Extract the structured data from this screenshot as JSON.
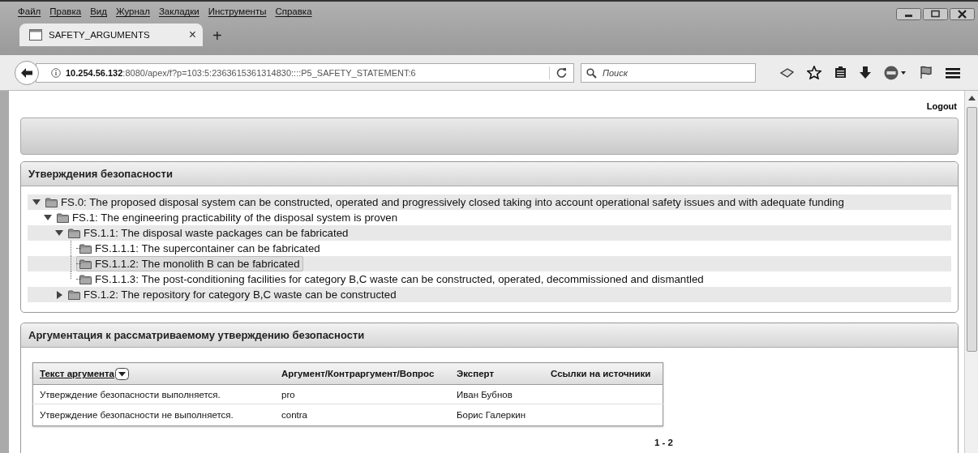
{
  "menu": [
    {
      "label": "Файл"
    },
    {
      "label": "Правка"
    },
    {
      "label": "Вид"
    },
    {
      "label": "Журнал"
    },
    {
      "label": "Закладки"
    },
    {
      "label": "Инструменты"
    },
    {
      "label": "Справка"
    }
  ],
  "tabs": [
    {
      "label": "SAFETY_ARGUMENTS",
      "selected": true
    }
  ],
  "tab_close": "×",
  "new_tab": "+",
  "address_bar": {
    "url": "**10.254.56.132**:8080/apex/f?p=103:5:2363615361314830::::P5_SAFETY_STATEMENT:6"
  },
  "search": {
    "placeholder": "Поиск"
  },
  "page": {
    "logout": "Logout",
    "statements_panel": {
      "title": "Утверждения безопасности",
      "tree": [
        {
          "kind": "branch",
          "expanded": true,
          "selected": false,
          "label": "FS.0: The proposed disposal system can be constructed, operated and progressively closed taking into account operational safety issues and with adequate funding",
          "children": [
            {
              "kind": "branch",
              "expanded": true,
              "selected": false,
              "label": "FS.1: The engineering practicability of the disposal system is proven",
              "children": [
                {
                  "kind": "branch",
                  "expanded": true,
                  "selected": false,
                  "label": "FS.1.1: The disposal waste packages can be fabricated",
                  "children": [
                    {
                      "kind": "leaf",
                      "selected": false,
                      "label": "FS.1.1.1: The supercontainer can be fabricated"
                    },
                    {
                      "kind": "leaf",
                      "selected": true,
                      "label": "FS.1.1.2: The monolith B can be fabricated"
                    },
                    {
                      "kind": "leaf",
                      "selected": false,
                      "label": "FS.1.1.3: The post-conditioning facilities for category B,C waste can be constructed, operated, decommissioned and dismantled"
                    }
                  ]
                },
                {
                  "kind": "branch",
                  "expanded": false,
                  "selected": false,
                  "label": "FS.1.2: The repository for category B,C waste can be constructed"
                }
              ]
            }
          ]
        }
      ]
    },
    "arguments_panel": {
      "title": "Аргументация к рассматриваемому утверждению безопасности",
      "table": {
        "columns": [
          {
            "label": "Текст аргумента",
            "kind": "sortable"
          },
          {
            "label": "Аргумент/Контраргумент/Вопрос",
            "kind": "plain"
          },
          {
            "label": "Эксперт",
            "kind": "plain"
          },
          {
            "label": "Ссылки на источники",
            "kind": "plain"
          }
        ],
        "rows": [
          [
            "Утверждение безопасности выполняется.",
            "pro",
            "Иван Бубнов",
            ""
          ],
          [
            "Утверждение безопасности не выполняется.",
            "contra",
            "Борис Галеркин",
            ""
          ]
        ]
      },
      "pagination": "1 - 2"
    }
  }
}
